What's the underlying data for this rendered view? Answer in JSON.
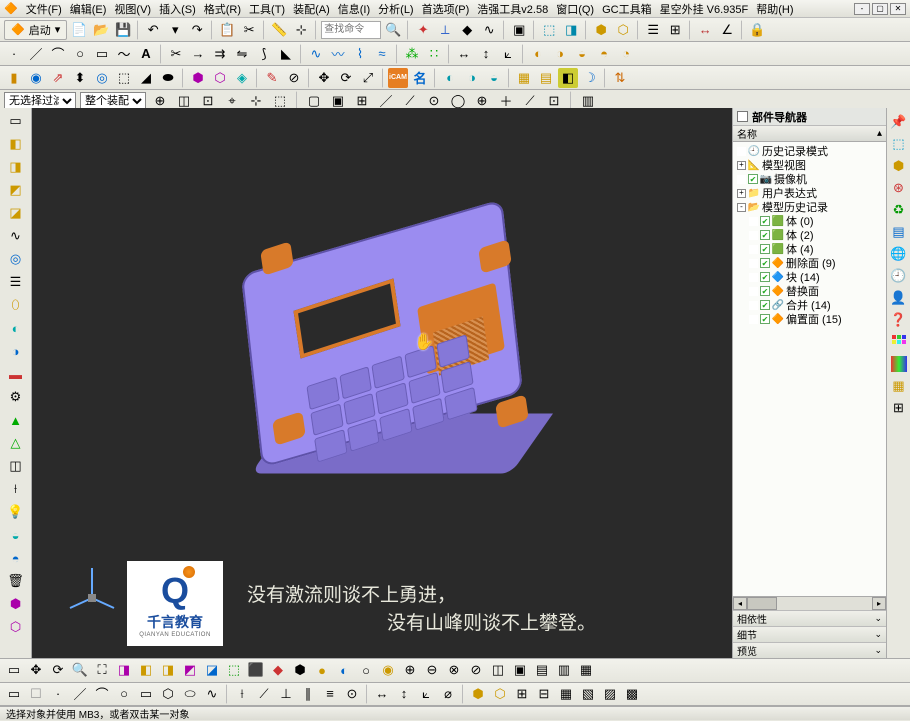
{
  "menu": {
    "file": "文件(F)",
    "edit": "编辑(E)",
    "view": "视图(V)",
    "insert": "插入(S)",
    "format": "格式(R)",
    "tools": "工具(T)",
    "assembly": "装配(A)",
    "info": "信息(I)",
    "analysis": "分析(L)",
    "prefs": "首选项(P)",
    "haoqiang": "浩强工具v2.58",
    "window": "窗口(Q)",
    "gc": "GC工具箱",
    "xingkong": "星空外挂 V6.935F",
    "help": "帮助(H)"
  },
  "toolbar1": {
    "start": "启动",
    "search_ph": "查找命令"
  },
  "filter": {
    "left_label": "无选择过滤器",
    "right_label": "整个装配"
  },
  "nav": {
    "title": "部件导航器",
    "col": "名称",
    "items": [
      {
        "depth": 0,
        "tw": "",
        "chk": "",
        "icon": "🕘",
        "label": "历史记录模式"
      },
      {
        "depth": 0,
        "tw": "+",
        "chk": "",
        "icon": "📐",
        "label": "模型视图"
      },
      {
        "depth": 0,
        "tw": "",
        "chk": "✔",
        "icon": "📷",
        "label": "摄像机"
      },
      {
        "depth": 0,
        "tw": "+",
        "chk": "",
        "icon": "📁",
        "label": "用户表达式"
      },
      {
        "depth": 0,
        "tw": "-",
        "chk": "",
        "icon": "📂",
        "label": "模型历史记录"
      },
      {
        "depth": 1,
        "tw": "",
        "chk": "✔",
        "icon": "🟩",
        "label": "体 (0)"
      },
      {
        "depth": 1,
        "tw": "",
        "chk": "✔",
        "icon": "🟩",
        "label": "体 (2)"
      },
      {
        "depth": 1,
        "tw": "",
        "chk": "✔",
        "icon": "🟩",
        "label": "体 (4)"
      },
      {
        "depth": 1,
        "tw": "",
        "chk": "✔",
        "icon": "🔶",
        "label": "删除面 (9)"
      },
      {
        "depth": 1,
        "tw": "",
        "chk": "✔",
        "icon": "🔷",
        "label": "块 (14)"
      },
      {
        "depth": 1,
        "tw": "",
        "chk": "✔",
        "icon": "🔶",
        "label": "替换面"
      },
      {
        "depth": 1,
        "tw": "",
        "chk": "✔",
        "icon": "🔗",
        "label": "合并 (14)"
      },
      {
        "depth": 1,
        "tw": "",
        "chk": "✔",
        "icon": "🔶",
        "label": "偏置面 (15)"
      }
    ],
    "sec1": "相依性",
    "sec2": "细节",
    "sec3": "预览"
  },
  "overlay": {
    "brand": "千言教育",
    "brand_en": "QIANYAN EDUCATION",
    "line1": "没有激流则谈不上勇进，",
    "line2": "没有山峰则谈不上攀登。"
  },
  "status": "选择对象并使用 MB3，或者双击某一对象"
}
